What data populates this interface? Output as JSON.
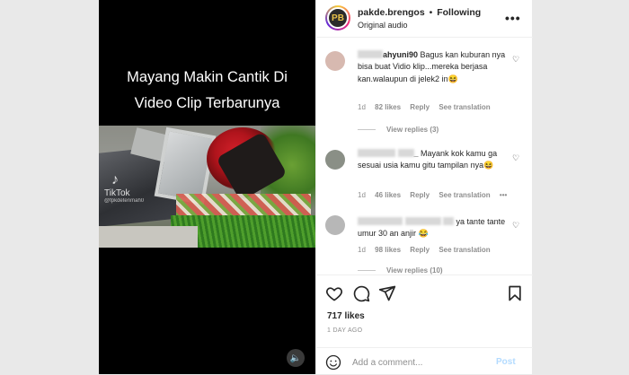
{
  "video": {
    "caption_line1": "Mayang Makin Cantik Di",
    "caption_line2": "Video Clip Terbarunya",
    "watermark": "TikTok",
    "watermark_user": "@fpkdetenmah0"
  },
  "header": {
    "username": "pakde.brengos",
    "separator": "•",
    "follow_status": "Following",
    "audio": "Original audio",
    "more": "•••"
  },
  "comments": [
    {
      "username_visible": "ahyuni90",
      "text": "Bagus kan kuburan nya bisa buat Vidio klip...mereka berjasa kan.walaupun di jelek2 in😆",
      "time": "1d",
      "likes": "82 likes",
      "reply": "Reply",
      "translation": "See translation",
      "view_replies": "View replies (3)"
    },
    {
      "username_visible": "_",
      "text": "Mayank kok kamu ga sesuai usia kamu gitu tampilan nya😆",
      "time": "1d",
      "likes": "46 likes",
      "reply": "Reply",
      "translation": "See translation",
      "more": "•••"
    },
    {
      "username_visible": "",
      "text": "ya tante tante umur 30 an anjir 😂",
      "time": "1d",
      "likes": "98 likes",
      "reply": "Reply",
      "translation": "See translation",
      "view_replies": "View replies (10)"
    }
  ],
  "actions": {
    "likes": "717 likes",
    "date": "1 DAY AGO"
  },
  "composer": {
    "placeholder": "Add a comment...",
    "post": "Post"
  }
}
